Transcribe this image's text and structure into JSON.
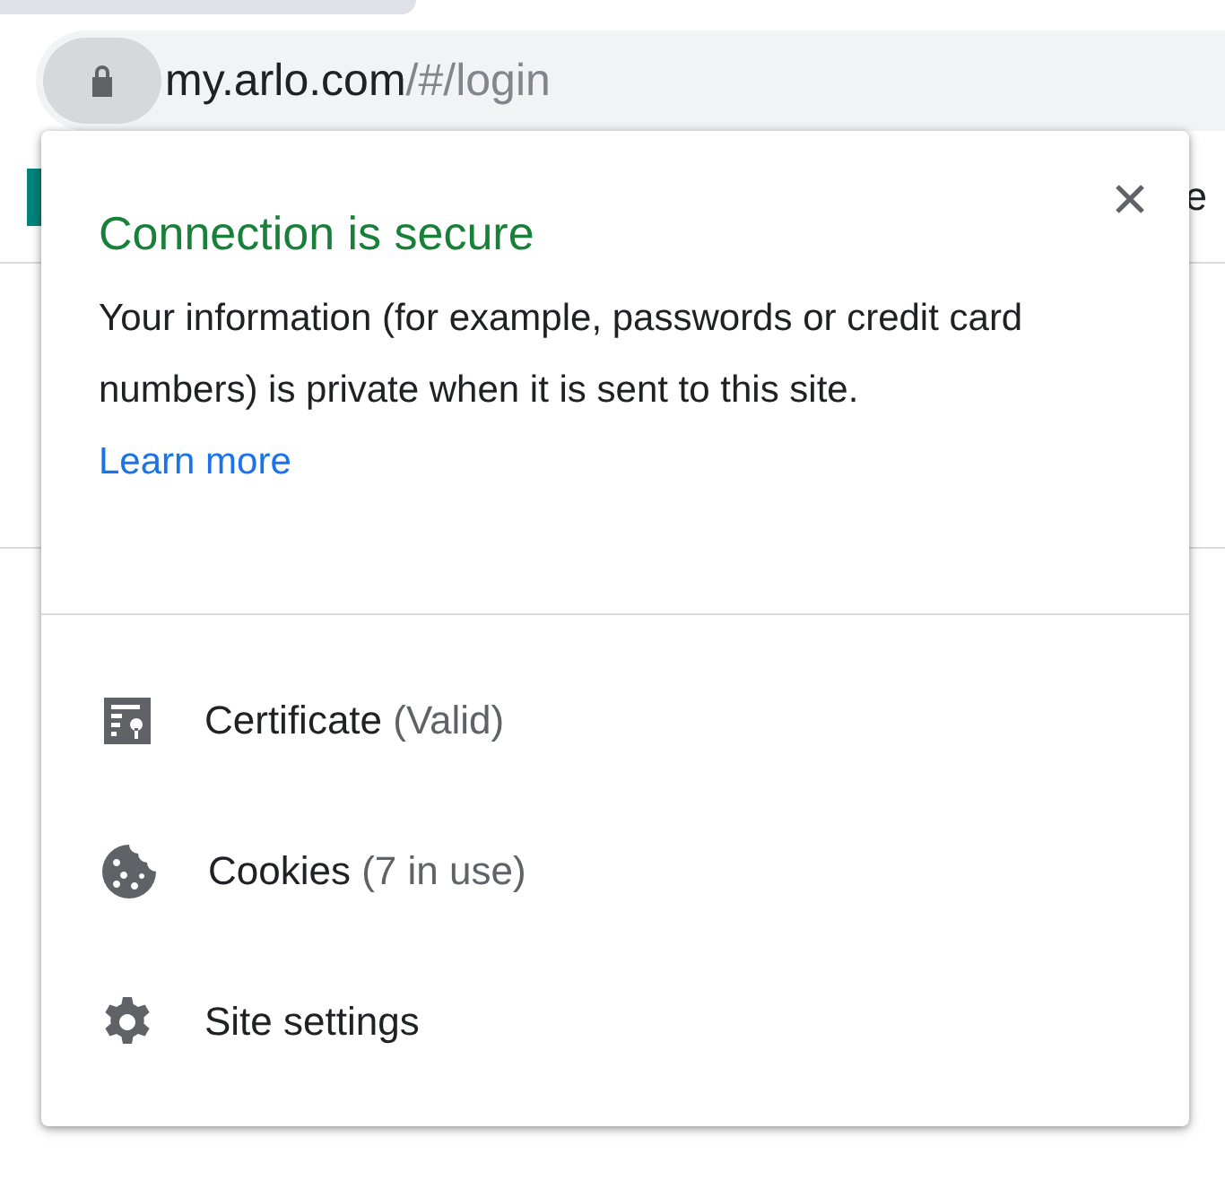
{
  "address_bar": {
    "host": "my.arlo.com",
    "path": "/#/login"
  },
  "background_page": {
    "partial_text": "e"
  },
  "popup": {
    "title": "Connection is secure",
    "message": "Your information (for example, passwords or credit card numbers) is private when it is sent to this site.",
    "link": "Learn more",
    "items": [
      {
        "kind": "certificate",
        "label": "Certificate",
        "detail": "(Valid)"
      },
      {
        "kind": "cookies",
        "label": "Cookies",
        "detail": "(7 in use)"
      },
      {
        "kind": "settings",
        "label": "Site settings"
      }
    ]
  }
}
